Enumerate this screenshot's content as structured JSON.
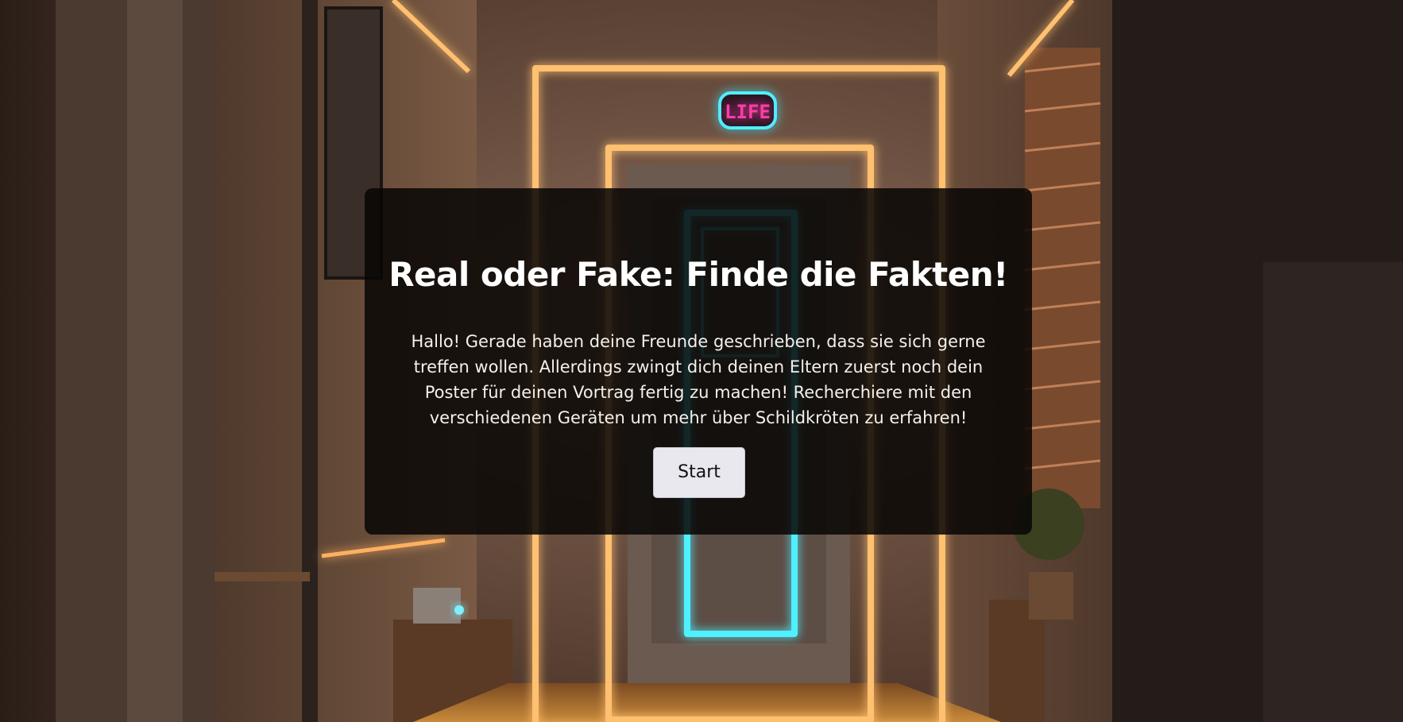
{
  "background": {
    "description_icon": "neon-hallway-background",
    "neon_sign_text": "LIFE",
    "colors": {
      "neon_orange": "#ffb45a",
      "neon_cyan": "#4ff0ff",
      "neon_pink": "#ff3da8",
      "wall": "#5a4032"
    }
  },
  "intro": {
    "title": "Real oder Fake: Finde die Fakten!",
    "text": "Hallo! Gerade haben deine Freunde geschrieben, dass sie sich gerne treffen wollen. Allerdings zwingt dich deinen Eltern zuerst noch dein Poster für deinen Vortrag fertig zu machen! Recherchiere mit den verschiedenen Geräten um mehr über Schildkröten zu erfahren!",
    "start_label": "Start"
  }
}
